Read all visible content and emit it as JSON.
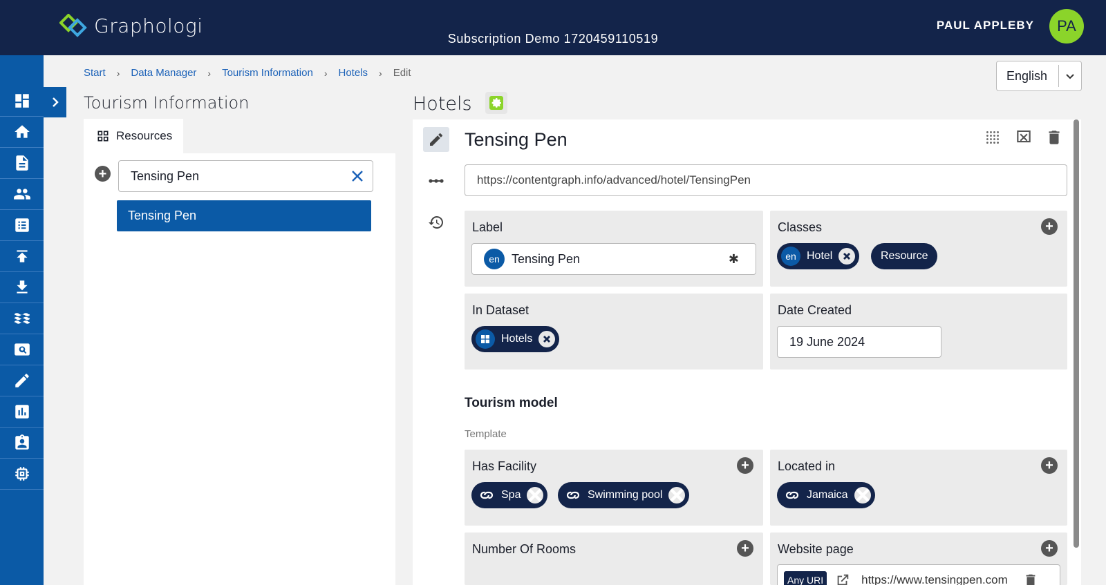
{
  "header": {
    "app_name": "Graphologi",
    "subscription": "Subscription Demo 1720459110519",
    "user_name": "PAUL APPLEBY",
    "user_initials": "PA"
  },
  "sidebar": {
    "items": [
      {
        "icon": "dashboard-icon"
      },
      {
        "icon": "home-icon"
      },
      {
        "icon": "document-icon"
      },
      {
        "icon": "people-icon"
      },
      {
        "icon": "list-icon"
      },
      {
        "icon": "upload-icon"
      },
      {
        "icon": "download-icon"
      },
      {
        "icon": "waves-icon"
      },
      {
        "icon": "search-icon"
      },
      {
        "icon": "edit-icon"
      },
      {
        "icon": "chart-icon"
      },
      {
        "icon": "badge-icon"
      },
      {
        "icon": "chip-icon"
      }
    ]
  },
  "breadcrumb": {
    "items": [
      "Start",
      "Data Manager",
      "Tourism Information",
      "Hotels"
    ],
    "current": "Edit"
  },
  "language": {
    "selected": "English"
  },
  "left_panel": {
    "title": "Tourism Information",
    "tab_label": "Resources",
    "search_value": "Tensing Pen",
    "results": [
      "Tensing Pen"
    ]
  },
  "right_panel": {
    "title": "Hotels",
    "resource_title": "Tensing Pen",
    "uri": "https://contentgraph.info/advanced/hotel/TensingPen",
    "label": {
      "heading": "Label",
      "lang": "en",
      "value": "Tensing Pen",
      "required_mark": "✱"
    },
    "classes": {
      "heading": "Classes",
      "chips": [
        {
          "lang": "en",
          "label": "Hotel"
        },
        {
          "label": "Resource"
        }
      ]
    },
    "in_dataset": {
      "heading": "In Dataset",
      "chip": "Hotels"
    },
    "date_created": {
      "heading": "Date Created",
      "value": "19 June 2024"
    },
    "section": {
      "title": "Tourism model",
      "subtitle": "Template"
    },
    "has_facility": {
      "heading": "Has Facility",
      "chips": [
        "Spa",
        "Swimming pool"
      ]
    },
    "located_in": {
      "heading": "Located in",
      "chips": [
        "Jamaica"
      ]
    },
    "number_of_rooms": {
      "heading": "Number Of Rooms"
    },
    "website_page": {
      "heading": "Website page",
      "type_badge": "Any URI",
      "value": "https://www.tensingpen.com"
    }
  },
  "colors": {
    "header_bg": "#13244a",
    "sidebar_bg": "#0b5aa6",
    "accent": "#1c62b8",
    "avatar_bg": "#8bd42a",
    "chip_bg": "#13244a"
  }
}
